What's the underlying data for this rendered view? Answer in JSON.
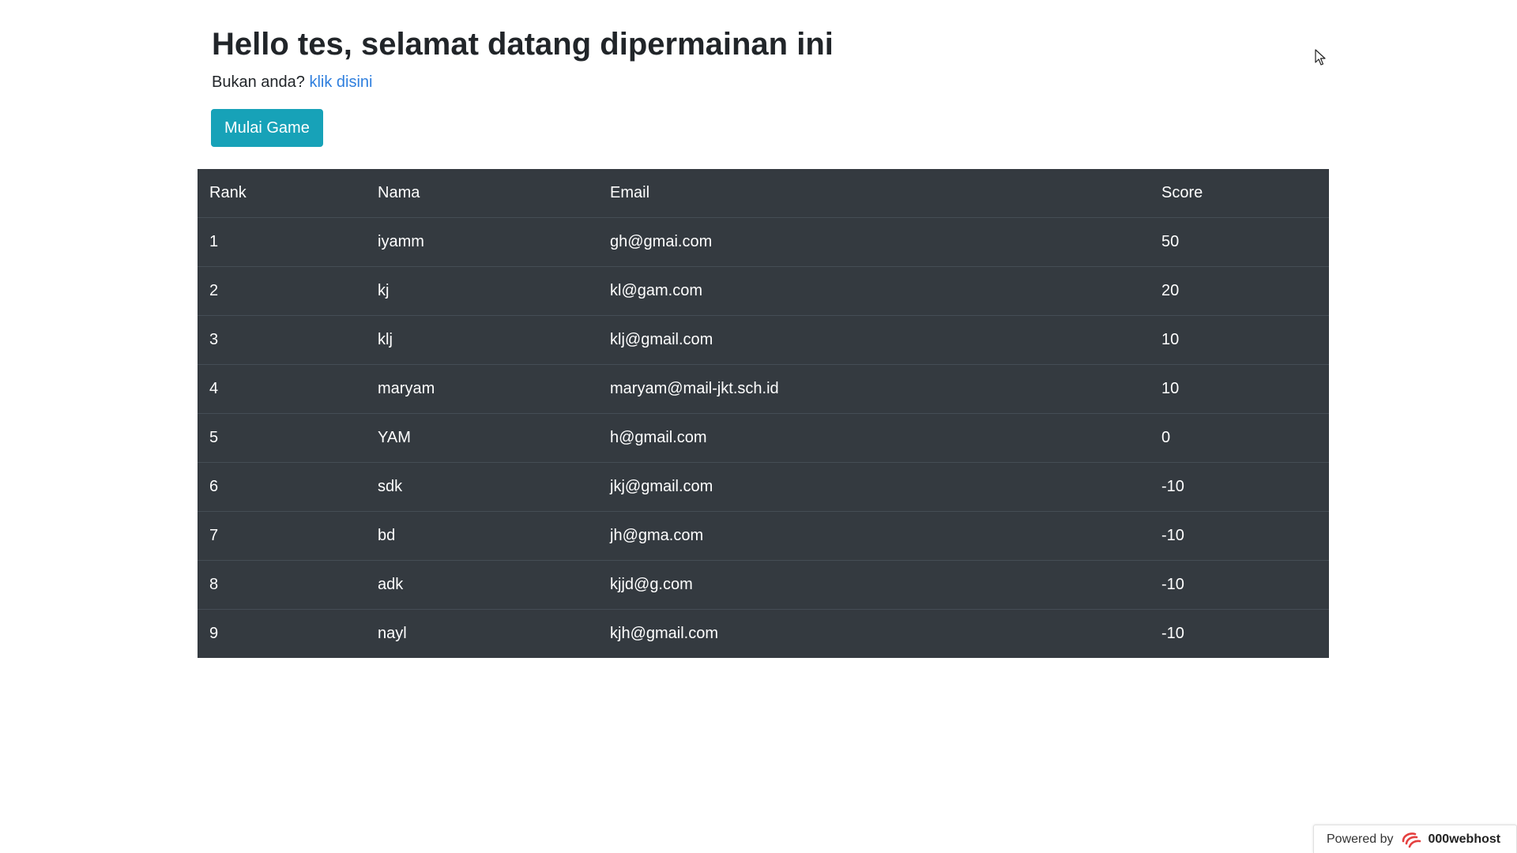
{
  "header": {
    "greeting": "Hello tes, selamat datang dipermainan ini",
    "not_you_text": "Bukan anda?",
    "not_you_link": "klik disini"
  },
  "actions": {
    "start_game_label": "Mulai Game"
  },
  "leaderboard": {
    "columns": [
      "Rank",
      "Nama",
      "Email",
      "Score"
    ],
    "rows": [
      [
        "1",
        "iyamm",
        "gh@gmai.com",
        "50"
      ],
      [
        "2",
        "kj",
        "kl@gam.com",
        "20"
      ],
      [
        "3",
        "klj",
        "klj@gmail.com",
        "10"
      ],
      [
        "4",
        "maryam",
        "maryam@mail-jkt.sch.id",
        "10"
      ],
      [
        "5",
        "YAM",
        "h@gmail.com",
        "0"
      ],
      [
        "6",
        "sdk",
        "jkj@gmail.com",
        "-10"
      ],
      [
        "7",
        "bd",
        "jh@gma.com",
        "-10"
      ],
      [
        "8",
        "adk",
        "kjjd@g.com",
        "-10"
      ],
      [
        "9",
        "nayl",
        "kjh@gmail.com",
        "-10"
      ]
    ]
  },
  "footer": {
    "powered_by": "Powered by",
    "brand": "000webhost"
  },
  "colors": {
    "button": "#17a2b8",
    "table_bg": "#343a40",
    "link": "#2f7fde",
    "brand_logo": "#e4403f"
  },
  "icons": {
    "brand_logo": "000webhost-logo-icon",
    "cursor": "mouse-pointer-icon"
  }
}
